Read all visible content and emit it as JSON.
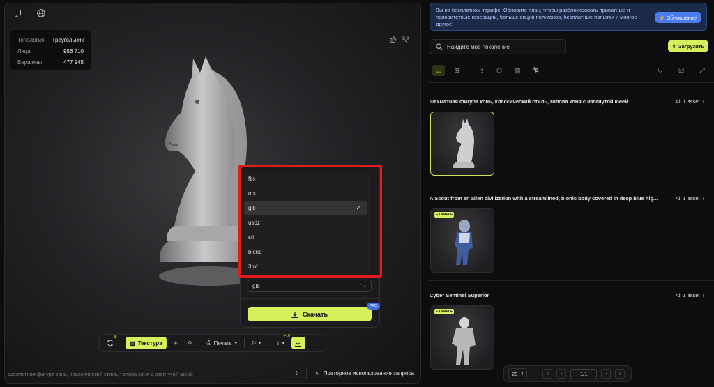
{
  "viewer": {
    "stats": [
      {
        "label": "Топология",
        "value": "Треугольник"
      },
      {
        "label": "Лица",
        "value": "956 710"
      },
      {
        "label": "Вершины",
        "value": "477 945"
      }
    ],
    "export": {
      "formats": [
        "fbx",
        "obj",
        "glb",
        "usdz",
        "stl",
        "blend",
        "3mf"
      ],
      "selected_format": "glb",
      "select_value": "glb",
      "download_label": "Скачать",
      "pro_badge": "PRO"
    },
    "toolbar": {
      "texture_label": "Текстура",
      "print_label": "Печать",
      "badge_count": "+10"
    },
    "prompt": {
      "text": "шахматная фигура конь, классический стиль, голова коня с изогнутой шеей",
      "reuse_label": "Повторное использование запроса"
    }
  },
  "sidebar": {
    "promo_text": "Вы на бесплатном тарифе. Обновите план, чтобы разблокировать приватные и приоритетные генерации, больше опций полигонов, бесплатные попытки и многое другое!",
    "upgrade_label": "Обновление",
    "search_placeholder": "Найдите мое поколение",
    "upload_label": "Загрузить",
    "groups": [
      {
        "title": "шахматная фигура конь, классический стиль, голова коня с изогнутой шеей",
        "all_label": "All 1 asset",
        "example": ""
      },
      {
        "title": "A Scout from an alien civilization with a streamlined, bionic body covered in deep blue hig...",
        "all_label": "All 1 asset",
        "example": "EXAMPLE"
      },
      {
        "title": "Cyber Sentinel Superior",
        "all_label": "All 1 asset",
        "example": "EXAMPLE"
      }
    ],
    "pager": {
      "page_size": "20",
      "current": "1/1"
    }
  },
  "colors": {
    "accent": "#d4f05a",
    "promo_bg": "#1c2a4a",
    "highlight": "#e31b1b",
    "upgrade": "#4a7cf0"
  }
}
